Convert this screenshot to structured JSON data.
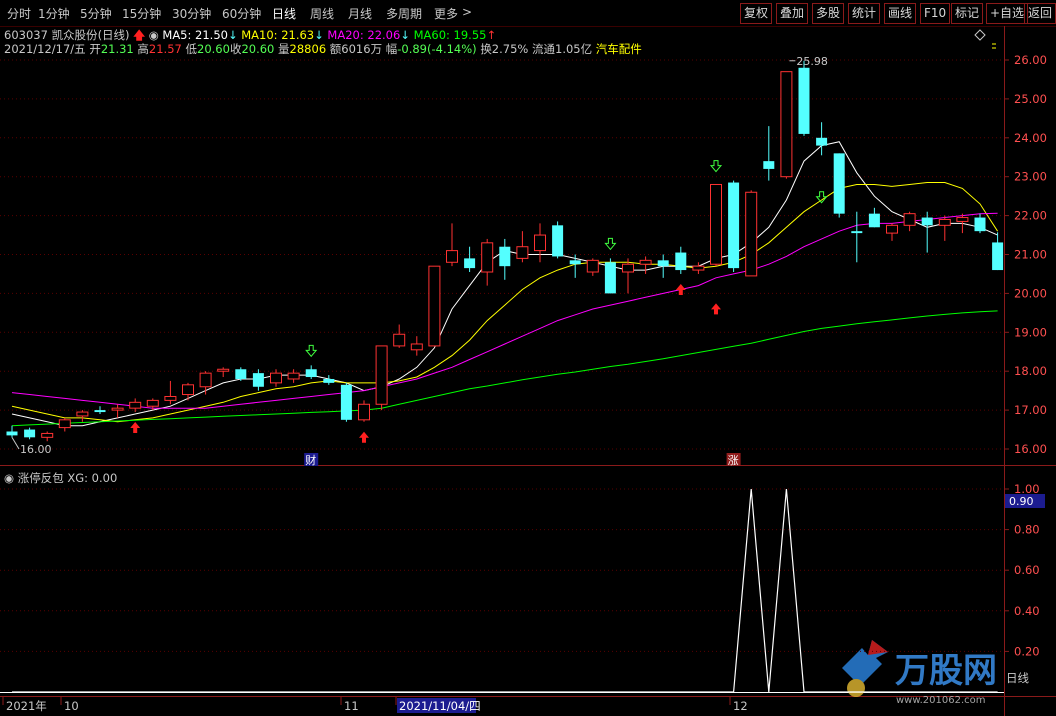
{
  "toolbar": {
    "timeframes": [
      "分时",
      "1分钟",
      "5分钟",
      "15分钟",
      "30分钟",
      "60分钟",
      "日线",
      "周线",
      "月线",
      "多周期",
      "更多"
    ],
    "active_timeframe": "日线",
    "buttons": [
      "复权",
      "叠加",
      "多股",
      "统计",
      "画线",
      "F10",
      "标记",
      "+自选",
      "返回"
    ]
  },
  "stock": {
    "code": "603037",
    "name": "凯众股份",
    "period": "(日线)",
    "ma5": "MA5: 21.50",
    "ma10": "MA10: 21.63",
    "ma20": "MA20: 22.06",
    "ma60": "MA60: 19.55"
  },
  "quote": {
    "date": "2021/12/17/五",
    "open_label": "开",
    "open": "21.31",
    "high_label": "高",
    "high": "21.57",
    "low_label": "低",
    "low": "20.60",
    "close_label": "收",
    "close": "20.60",
    "volume_label": "量",
    "volume": "28806",
    "amount_label": "额",
    "amount": "6016万",
    "change_label": "幅",
    "change": "-0.89(-4.14%)",
    "turnover": "换2.75%",
    "float_cap": "流通1.05亿",
    "sector": "汽车配件"
  },
  "indicator": {
    "name": "涨停反包",
    "xg": "XG: 0.00",
    "current_value_tag": "0.90"
  },
  "colors": {
    "up": "#ff3232",
    "down": "#54ffff",
    "ma5": "#ffffff",
    "ma10": "#ffff00",
    "ma20": "#ff00ff",
    "ma60": "#00ff00",
    "grid": "#5a0000",
    "axis_text": "#ff5050"
  },
  "x_axis_labels": [
    "2021年",
    "10",
    "11",
    "2021/11/04/四",
    "12",
    "日线"
  ],
  "markers": {
    "cai": "财",
    "zhang": "涨",
    "high_price": "25.98",
    "low_price": "16.00"
  },
  "watermark": {
    "text": "万股网",
    "url": "www.201062.com"
  },
  "chart_data": [
    {
      "type": "candlestick",
      "title": "凯众股份(日线)",
      "ylim": [
        15.6,
        26.4
      ],
      "yticks": [
        "26.00",
        "25.00",
        "24.00",
        "23.00",
        "22.00",
        "21.00",
        "20.00",
        "19.00",
        "18.00",
        "17.00",
        "16.00"
      ],
      "candles": [
        {
          "o": 16.45,
          "h": 16.6,
          "l": 16.3,
          "c": 16.35
        },
        {
          "o": 16.5,
          "h": 16.55,
          "l": 16.25,
          "c": 16.3
        },
        {
          "o": 16.3,
          "h": 16.45,
          "l": 16.2,
          "c": 16.4
        },
        {
          "o": 16.55,
          "h": 16.8,
          "l": 16.45,
          "c": 16.75
        },
        {
          "o": 16.85,
          "h": 17.0,
          "l": 16.7,
          "c": 16.95
        },
        {
          "o": 17.0,
          "h": 17.1,
          "l": 16.9,
          "c": 16.95
        },
        {
          "o": 17.0,
          "h": 17.15,
          "l": 16.8,
          "c": 17.05
        },
        {
          "o": 17.05,
          "h": 17.3,
          "l": 16.95,
          "c": 17.2
        },
        {
          "o": 17.1,
          "h": 17.3,
          "l": 17.0,
          "c": 17.25
        },
        {
          "o": 17.25,
          "h": 17.75,
          "l": 17.15,
          "c": 17.35
        },
        {
          "o": 17.4,
          "h": 17.7,
          "l": 17.25,
          "c": 17.65
        },
        {
          "o": 17.6,
          "h": 18.0,
          "l": 17.4,
          "c": 17.95
        },
        {
          "o": 18.0,
          "h": 18.1,
          "l": 17.85,
          "c": 18.05
        },
        {
          "o": 18.05,
          "h": 18.1,
          "l": 17.75,
          "c": 17.8
        },
        {
          "o": 17.95,
          "h": 18.05,
          "l": 17.5,
          "c": 17.6
        },
        {
          "o": 17.7,
          "h": 18.05,
          "l": 17.6,
          "c": 17.95
        },
        {
          "o": 17.8,
          "h": 18.05,
          "l": 17.7,
          "c": 17.95
        },
        {
          "o": 18.05,
          "h": 18.15,
          "l": 17.8,
          "c": 17.85
        },
        {
          "o": 17.8,
          "h": 17.9,
          "l": 17.65,
          "c": 17.7
        },
        {
          "o": 17.65,
          "h": 17.7,
          "l": 16.7,
          "c": 16.75
        },
        {
          "o": 16.75,
          "h": 17.25,
          "l": 16.7,
          "c": 17.15
        },
        {
          "o": 17.15,
          "h": 18.65,
          "l": 17.0,
          "c": 18.65
        },
        {
          "o": 18.65,
          "h": 19.2,
          "l": 18.6,
          "c": 18.95
        },
        {
          "o": 18.55,
          "h": 18.9,
          "l": 18.4,
          "c": 18.7
        },
        {
          "o": 18.65,
          "h": 20.7,
          "l": 18.65,
          "c": 20.7
        },
        {
          "o": 20.8,
          "h": 21.8,
          "l": 20.7,
          "c": 21.1
        },
        {
          "o": 20.9,
          "h": 21.2,
          "l": 20.55,
          "c": 20.65
        },
        {
          "o": 20.55,
          "h": 21.4,
          "l": 20.2,
          "c": 21.3
        },
        {
          "o": 21.2,
          "h": 21.4,
          "l": 20.35,
          "c": 20.7
        },
        {
          "o": 20.9,
          "h": 21.6,
          "l": 20.8,
          "c": 21.2
        },
        {
          "o": 21.1,
          "h": 21.8,
          "l": 20.8,
          "c": 21.5
        },
        {
          "o": 21.75,
          "h": 21.85,
          "l": 20.9,
          "c": 20.95
        },
        {
          "o": 20.85,
          "h": 21.0,
          "l": 20.4,
          "c": 20.75
        },
        {
          "o": 20.55,
          "h": 20.9,
          "l": 20.45,
          "c": 20.85
        },
        {
          "o": 20.8,
          "h": 20.9,
          "l": 20.0,
          "c": 20.0
        },
        {
          "o": 20.55,
          "h": 20.9,
          "l": 20.0,
          "c": 20.75
        },
        {
          "o": 20.75,
          "h": 20.95,
          "l": 20.5,
          "c": 20.85
        },
        {
          "o": 20.85,
          "h": 21.0,
          "l": 20.4,
          "c": 20.7
        },
        {
          "o": 21.05,
          "h": 21.2,
          "l": 20.5,
          "c": 20.6
        },
        {
          "o": 20.6,
          "h": 20.8,
          "l": 20.5,
          "c": 20.7
        },
        {
          "o": 20.75,
          "h": 22.8,
          "l": 20.7,
          "c": 22.8
        },
        {
          "o": 22.85,
          "h": 22.9,
          "l": 20.55,
          "c": 20.65
        },
        {
          "o": 20.45,
          "h": 22.65,
          "l": 20.45,
          "c": 22.6
        },
        {
          "o": 23.4,
          "h": 24.3,
          "l": 22.9,
          "c": 23.2
        },
        {
          "o": 23.0,
          "h": 25.7,
          "l": 22.95,
          "c": 25.7
        },
        {
          "o": 25.8,
          "h": 25.98,
          "l": 24.05,
          "c": 24.1
        },
        {
          "o": 24.0,
          "h": 24.4,
          "l": 23.55,
          "c": 23.8
        },
        {
          "o": 23.6,
          "h": 23.6,
          "l": 21.95,
          "c": 22.05
        },
        {
          "o": 21.6,
          "h": 22.1,
          "l": 20.8,
          "c": 21.55
        },
        {
          "o": 22.05,
          "h": 22.2,
          "l": 21.7,
          "c": 21.7
        },
        {
          "o": 21.55,
          "h": 21.8,
          "l": 21.35,
          "c": 21.75
        },
        {
          "o": 21.75,
          "h": 22.1,
          "l": 21.6,
          "c": 22.05
        },
        {
          "o": 21.95,
          "h": 22.1,
          "l": 21.05,
          "c": 21.75
        },
        {
          "o": 21.75,
          "h": 22.0,
          "l": 21.35,
          "c": 21.9
        },
        {
          "o": 21.85,
          "h": 22.05,
          "l": 21.55,
          "c": 21.95
        },
        {
          "o": 21.95,
          "h": 22.05,
          "l": 21.55,
          "c": 21.6
        },
        {
          "o": 21.31,
          "h": 21.57,
          "l": 20.6,
          "c": 20.6
        }
      ],
      "ma_series": [
        {
          "name": "MA5",
          "values": [
            16.9,
            16.8,
            16.7,
            16.6,
            16.6,
            16.7,
            16.8,
            16.9,
            17.0,
            17.1,
            17.3,
            17.5,
            17.7,
            17.8,
            17.8,
            17.9,
            17.9,
            17.9,
            17.8,
            17.7,
            17.5,
            17.6,
            17.8,
            18.1,
            18.6,
            19.6,
            20.2,
            20.8,
            21.1,
            21.0,
            21.0,
            21.0,
            20.9,
            20.8,
            20.7,
            20.6,
            20.6,
            20.7,
            20.7,
            20.7,
            20.9,
            21.0,
            21.3,
            21.7,
            22.4,
            23.4,
            23.8,
            23.9,
            23.1,
            22.5,
            22.1,
            21.9,
            21.7,
            21.8,
            21.8,
            21.7,
            21.5
          ]
        },
        {
          "name": "MA10",
          "values": [
            17.1,
            17.0,
            16.9,
            16.8,
            16.8,
            16.75,
            16.7,
            16.75,
            16.8,
            16.9,
            17.0,
            17.1,
            17.2,
            17.35,
            17.45,
            17.55,
            17.6,
            17.7,
            17.75,
            17.7,
            17.7,
            17.7,
            17.75,
            17.85,
            18.1,
            18.4,
            18.8,
            19.3,
            19.7,
            20.1,
            20.4,
            20.6,
            20.75,
            20.8,
            20.8,
            20.8,
            20.75,
            20.75,
            20.7,
            20.65,
            20.7,
            20.8,
            21.0,
            21.3,
            21.7,
            22.1,
            22.4,
            22.7,
            22.8,
            22.8,
            22.75,
            22.8,
            22.85,
            22.85,
            22.7,
            22.3,
            21.6
          ]
        },
        {
          "name": "MA20",
          "values": [
            17.45,
            17.4,
            17.35,
            17.3,
            17.25,
            17.2,
            17.15,
            17.1,
            17.05,
            17.05,
            17.05,
            17.05,
            17.1,
            17.15,
            17.2,
            17.25,
            17.3,
            17.35,
            17.4,
            17.45,
            17.5,
            17.6,
            17.7,
            17.8,
            17.95,
            18.1,
            18.3,
            18.5,
            18.7,
            18.9,
            19.1,
            19.3,
            19.45,
            19.6,
            19.7,
            19.8,
            19.9,
            20.0,
            20.1,
            20.2,
            20.4,
            20.5,
            20.6,
            20.75,
            20.95,
            21.2,
            21.4,
            21.6,
            21.75,
            21.8,
            21.8,
            21.85,
            21.9,
            21.95,
            22.0,
            22.05,
            22.06
          ]
        },
        {
          "name": "MA60",
          "values": [
            16.6,
            16.62,
            16.64,
            16.66,
            16.68,
            16.7,
            16.72,
            16.74,
            16.76,
            16.78,
            16.8,
            16.82,
            16.84,
            16.86,
            16.88,
            16.9,
            16.92,
            16.94,
            16.96,
            16.98,
            17.0,
            17.05,
            17.15,
            17.25,
            17.35,
            17.45,
            17.55,
            17.62,
            17.7,
            17.78,
            17.85,
            17.92,
            17.98,
            18.05,
            18.12,
            18.18,
            18.25,
            18.32,
            18.4,
            18.48,
            18.56,
            18.64,
            18.72,
            18.82,
            18.92,
            19.02,
            19.1,
            19.16,
            19.22,
            19.27,
            19.32,
            19.37,
            19.42,
            19.46,
            19.5,
            19.53,
            19.55
          ]
        }
      ]
    },
    {
      "type": "line",
      "title": "涨停反包",
      "series": [
        {
          "name": "XG",
          "values": [
            0,
            0,
            0,
            0,
            0,
            0,
            0,
            0,
            0,
            0,
            0,
            0,
            0,
            0,
            0,
            0,
            0,
            0,
            0,
            0,
            0,
            0,
            0,
            0,
            0,
            0,
            0,
            0,
            0,
            0,
            0,
            0,
            0,
            0,
            0,
            0,
            0,
            0,
            0,
            0,
            0,
            0,
            1,
            0,
            1,
            0,
            0,
            0,
            0,
            0,
            0,
            0,
            0,
            0,
            0,
            0,
            0
          ]
        }
      ],
      "ylim": [
        0,
        1.05
      ],
      "yticks": [
        "1.00",
        "0.80",
        "0.60",
        "0.40",
        "0.20"
      ]
    }
  ]
}
